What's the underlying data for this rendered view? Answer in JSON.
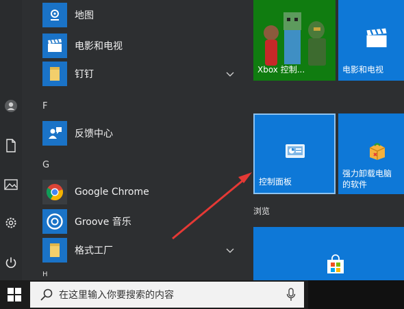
{
  "start_menu": {
    "apps": [
      {
        "label": "地图",
        "icon": "map-icon"
      },
      {
        "label": "电影和电视",
        "icon": "clapperboard-icon"
      },
      {
        "label": "钉钉",
        "icon": "folder-icon",
        "expandable": true
      },
      {
        "label": "反馈中心",
        "icon": "feedback-icon"
      },
      {
        "label": "Google Chrome",
        "icon": "chrome-icon"
      },
      {
        "label": "Groove 音乐",
        "icon": "groove-music-icon"
      },
      {
        "label": "格式工厂",
        "icon": "folder-icon",
        "expandable": true
      }
    ],
    "letters": {
      "f": "F",
      "g": "G",
      "h": "H"
    },
    "tiles": {
      "xbox": {
        "label": "Xbox 控制..."
      },
      "movies": {
        "label": "电影和电视"
      },
      "control_panel": {
        "label": "控制面板"
      },
      "uninstaller": {
        "label_line1": "强力卸载电脑",
        "label_line2": "的软件"
      }
    },
    "groups": {
      "browse": "浏览"
    }
  },
  "taskbar": {
    "search_placeholder": "在这里输入你要搜索的内容"
  },
  "colors": {
    "accent": "#1a73c7",
    "tile_blue": "#0e78d7",
    "xbox_green": "#107c10",
    "arrow": "#e53935"
  }
}
